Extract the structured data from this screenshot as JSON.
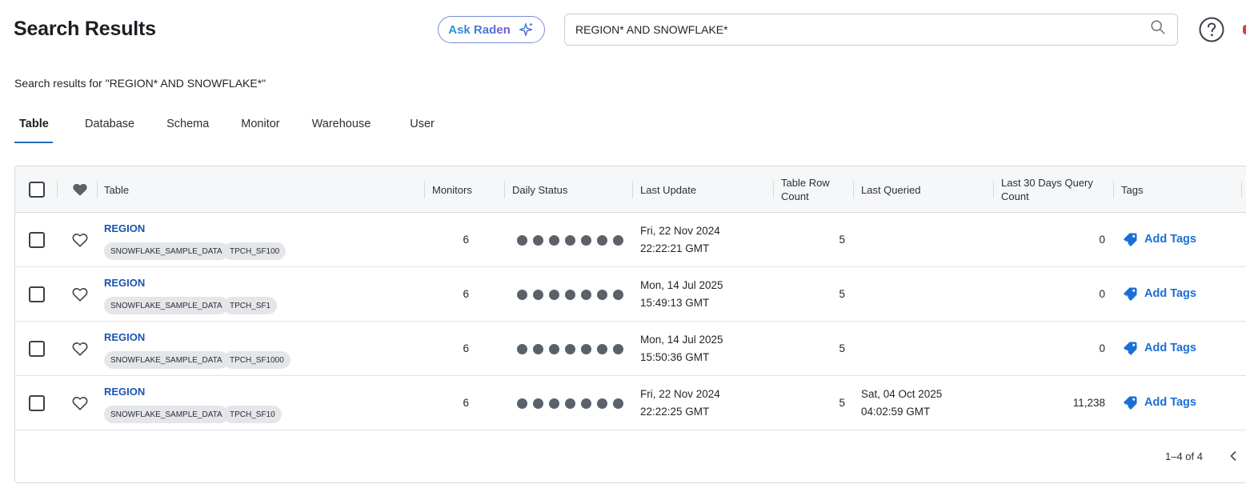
{
  "header": {
    "title": "Search Results",
    "ask_button_label": "Ask Raden",
    "search_value": "REGION* AND SNOWFLAKE*"
  },
  "results_caption": "Search results for \"REGION* AND SNOWFLAKE*\"",
  "tabs": [
    {
      "label": "Table",
      "active": true
    },
    {
      "label": "Database",
      "active": false
    },
    {
      "label": "Schema",
      "active": false
    },
    {
      "label": "Monitor",
      "active": false
    },
    {
      "label": "Warehouse",
      "active": false
    },
    {
      "label": "User",
      "active": false
    }
  ],
  "columns": {
    "table": "Table",
    "monitors": "Monitors",
    "daily_status": "Daily Status",
    "last_update": "Last Update",
    "row_count": "Table Row Count",
    "last_queried": "Last Queried",
    "query_count": "Last 30 Days Query Count",
    "tags": "Tags"
  },
  "rows": [
    {
      "name": "REGION",
      "database": "SNOWFLAKE_SAMPLE_DATA",
      "schema": "TPCH_SF100",
      "monitors": "6",
      "last_update_date": "Fri, 22 Nov 2024",
      "last_update_time": "22:22:21 GMT",
      "row_count": "5",
      "last_queried_date": "",
      "last_queried_time": "",
      "query_count": "0",
      "add_tags": "Add Tags"
    },
    {
      "name": "REGION",
      "database": "SNOWFLAKE_SAMPLE_DATA",
      "schema": "TPCH_SF1",
      "monitors": "6",
      "last_update_date": "Mon, 14 Jul 2025",
      "last_update_time": "15:49:13 GMT",
      "row_count": "5",
      "last_queried_date": "",
      "last_queried_time": "",
      "query_count": "0",
      "add_tags": "Add Tags"
    },
    {
      "name": "REGION",
      "database": "SNOWFLAKE_SAMPLE_DATA",
      "schema": "TPCH_SF1000",
      "monitors": "6",
      "last_update_date": "Mon, 14 Jul 2025",
      "last_update_time": "15:50:36 GMT",
      "row_count": "5",
      "last_queried_date": "",
      "last_queried_time": "",
      "query_count": "0",
      "add_tags": "Add Tags"
    },
    {
      "name": "REGION",
      "database": "SNOWFLAKE_SAMPLE_DATA",
      "schema": "TPCH_SF10",
      "monitors": "6",
      "last_update_date": "Fri, 22 Nov 2024",
      "last_update_time": "22:22:25 GMT",
      "row_count": "5",
      "last_queried_date": "Sat, 04 Oct 2025",
      "last_queried_time": "04:02:59 GMT",
      "query_count": "11,238",
      "add_tags": "Add Tags"
    }
  ],
  "pagination": {
    "range": "1–4 of 4"
  },
  "colors": {
    "accent": "#1f6fb5",
    "link": "#1a55b0",
    "status_dot": "#5b6169"
  },
  "icons": [
    "sparkle-icon",
    "search-icon",
    "help-icon",
    "heart-icon",
    "tag-add-icon",
    "chevron-left-icon"
  ]
}
